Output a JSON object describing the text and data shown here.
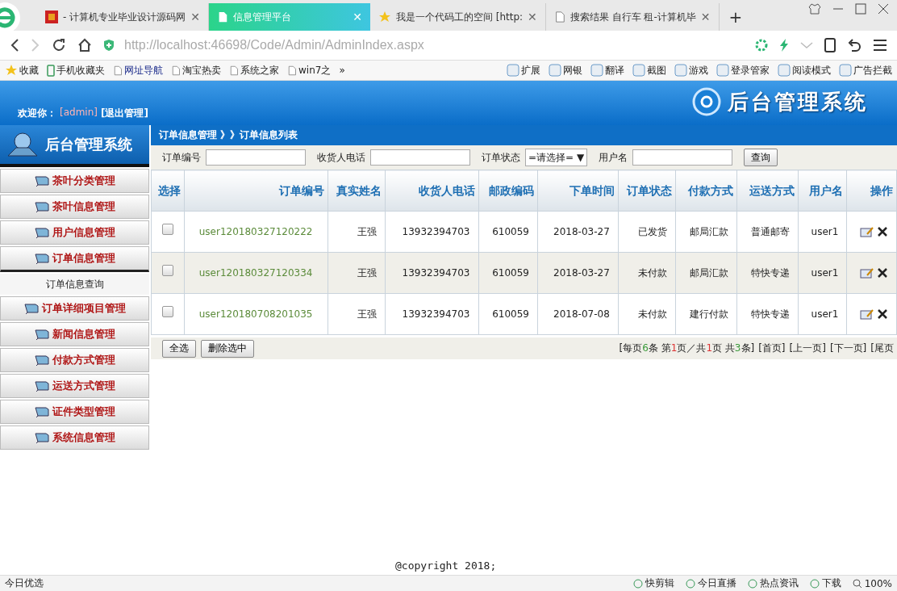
{
  "browser": {
    "tabs": [
      {
        "title": "- 计算机专业毕业设计源码网",
        "selected": false
      },
      {
        "title": "信息管理平台",
        "selected": true
      },
      {
        "title": "我是一个代码工的空间 [http:",
        "selected": false
      },
      {
        "title": "搜索结果 自行车 租-计算机毕",
        "selected": false
      }
    ],
    "close_mark": "✕",
    "new_tab": "+",
    "address": {
      "host": "http://localhost",
      "path": ":46698/Code/Admin/AdminIndex.aspx"
    },
    "bookmarks": [
      {
        "label": "收藏"
      },
      {
        "label": "手机收藏夹"
      },
      {
        "label": "网址导航"
      },
      {
        "label": "淘宝热卖"
      },
      {
        "label": "系统之家"
      },
      {
        "label": "win7之"
      }
    ],
    "more": "»",
    "tools": [
      "扩展",
      "网银",
      "翻译",
      "截图",
      "游戏",
      "登录管家",
      "阅读模式",
      "广告拦截"
    ]
  },
  "header": {
    "welcome": "欢迎你：",
    "user": "[admin]",
    "logout": "[退出管理]",
    "title": "后台管理系统"
  },
  "sidebar": {
    "title": "后台管理系统",
    "items": [
      {
        "label": "茶叶分类管理",
        "expanded": false
      },
      {
        "label": "茶叶信息管理",
        "expanded": false
      },
      {
        "label": "用户信息管理",
        "expanded": false
      },
      {
        "label": "订单信息管理",
        "expanded": true,
        "children": [
          {
            "label": "订单信息查询"
          }
        ]
      },
      {
        "label": "订单详细项目管理",
        "expanded": false
      },
      {
        "label": "新闻信息管理",
        "expanded": false
      },
      {
        "label": "付款方式管理",
        "expanded": false
      },
      {
        "label": "运送方式管理",
        "expanded": false
      },
      {
        "label": "证件类型管理",
        "expanded": false
      },
      {
        "label": "系统信息管理",
        "expanded": false
      }
    ]
  },
  "breadcrumb": "订单信息管理 》》订单信息列表",
  "search": {
    "fields": [
      {
        "label": "订单编号",
        "kind": "text"
      },
      {
        "label": "收货人电话",
        "kind": "text"
      },
      {
        "label": "订单状态",
        "kind": "select",
        "value": "=请选择=",
        "arrow": "▼"
      },
      {
        "label": "用户名",
        "kind": "text"
      }
    ],
    "button": "查询"
  },
  "table": {
    "columns": [
      "选择",
      "订单编号",
      "真实姓名",
      "收货人电话",
      "邮政编码",
      "下单时间",
      "订单状态",
      "付款方式",
      "运送方式",
      "用户名",
      "操作"
    ],
    "rows": [
      {
        "checked": false,
        "cells": [
          "",
          "user120180327120222",
          "王强",
          "13932394703",
          "610059",
          "2018-03-27",
          "已发货",
          "邮局汇款",
          "普通邮寄",
          "user1"
        ]
      },
      {
        "checked": false,
        "cells": [
          "",
          "user120180327120334",
          "王强",
          "13932394703",
          "610059",
          "2018-03-27",
          "未付款",
          "邮局汇款",
          "特快专递",
          "user1"
        ]
      },
      {
        "checked": false,
        "cells": [
          "",
          "user120180708201035",
          "王强",
          "13932394703",
          "610059",
          "2018-07-08",
          "未付款",
          "建行付款",
          "特快专递",
          "user1"
        ]
      }
    ]
  },
  "actions": [
    "全选",
    "删除选中"
  ],
  "pager": {
    "summary": [
      {
        "text": "[每页",
        "kind": "text"
      },
      {
        "text": "6",
        "kind": "count"
      },
      {
        "text": "条 第",
        "kind": "text"
      },
      {
        "text": "1",
        "kind": "page"
      },
      {
        "text": "页／共",
        "kind": "text"
      },
      {
        "text": "1",
        "kind": "page"
      },
      {
        "text": "页 共",
        "kind": "text"
      },
      {
        "text": "3",
        "kind": "count"
      },
      {
        "text": "条]",
        "kind": "text"
      }
    ],
    "links": [
      "[首页]",
      "[上一页]",
      "[下一页]",
      "[尾页"
    ]
  },
  "copyright": "@copyright 2018;",
  "status_bar": {
    "left": "今日优选",
    "items": [
      "快剪辑",
      "今日直播",
      "热点资讯",
      "下载"
    ],
    "zoom": "100%"
  }
}
